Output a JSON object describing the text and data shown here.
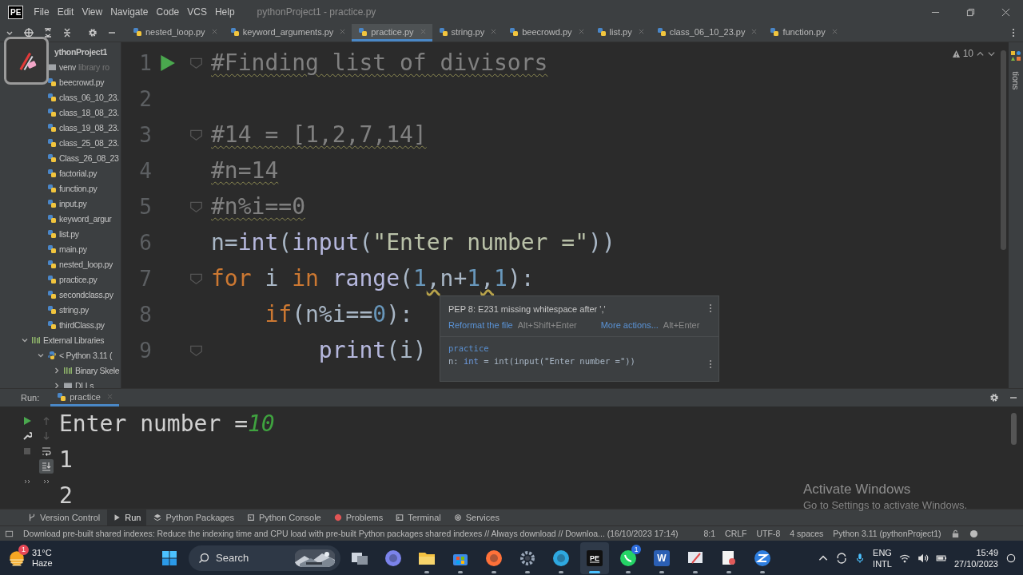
{
  "window": {
    "logo": "PE",
    "title": "pythonProject1 - practice.py"
  },
  "menu": [
    "File",
    "Edit",
    "View",
    "Navigate",
    "Code",
    "VCS",
    "Help"
  ],
  "tabs": [
    {
      "label": "nested_loop.py",
      "selected": false
    },
    {
      "label": "keyword_arguments.py",
      "selected": false
    },
    {
      "label": "practice.py",
      "selected": true
    },
    {
      "label": "string.py",
      "selected": false
    },
    {
      "label": "beecrowd.py",
      "selected": false
    },
    {
      "label": "list.py",
      "selected": false
    },
    {
      "label": "class_06_10_23.py",
      "selected": false
    },
    {
      "label": "function.py",
      "selected": false
    }
  ],
  "project_tree": [
    {
      "label": "ythonProject1",
      "kind": "root",
      "children": [
        {
          "label": "venv",
          "note": "library ro",
          "kind": "folder"
        },
        {
          "label": "beecrowd.py",
          "kind": "file"
        },
        {
          "label": "class_06_10_23.",
          "kind": "file"
        },
        {
          "label": "class_18_08_23.",
          "kind": "file"
        },
        {
          "label": "class_19_08_23.",
          "kind": "file"
        },
        {
          "label": "class_25_08_23.",
          "kind": "file"
        },
        {
          "label": "Class_26_08_23",
          "kind": "file"
        },
        {
          "label": "factorial.py",
          "kind": "file"
        },
        {
          "label": "function.py",
          "kind": "file"
        },
        {
          "label": "input.py",
          "kind": "file"
        },
        {
          "label": "keyword_argur",
          "kind": "file"
        },
        {
          "label": "list.py",
          "kind": "file"
        },
        {
          "label": "main.py",
          "kind": "file"
        },
        {
          "label": "nested_loop.py",
          "kind": "file"
        },
        {
          "label": "practice.py",
          "kind": "file"
        },
        {
          "label": "secondclass.py",
          "kind": "file"
        },
        {
          "label": "string.py",
          "kind": "file"
        },
        {
          "label": "thirdClass.py",
          "kind": "file"
        }
      ]
    },
    {
      "label": "External Libraries",
      "kind": "library",
      "expanded": true,
      "children": [
        {
          "label": "< Python 3.11 (",
          "kind": "python",
          "expanded": true,
          "children": [
            {
              "label": "Binary Skele",
              "kind": "library",
              "expanded": false
            },
            {
              "label": "DLLs",
              "kind": "folder",
              "expanded": false
            }
          ]
        }
      ]
    }
  ],
  "inspections": {
    "count": "10"
  },
  "editor_lines": [
    {
      "number": "1",
      "run": true,
      "fold": true,
      "tokens": [
        {
          "text": "#Finding list of divisors",
          "kind": "comment"
        }
      ]
    },
    {
      "number": "2",
      "run": false,
      "fold": false
    },
    {
      "number": "3",
      "run": false,
      "fold": true,
      "tokens": [
        {
          "text": "#14 = [1,2,7,14]",
          "kind": "comment"
        }
      ]
    },
    {
      "number": "4",
      "run": false,
      "fold": false,
      "tokens": [
        {
          "text": "#n=14",
          "kind": "comment"
        }
      ]
    },
    {
      "number": "5",
      "run": false,
      "fold": true,
      "tokens": [
        {
          "text": "#n%i==0",
          "kind": "comment"
        }
      ]
    },
    {
      "number": "6",
      "run": false,
      "fold": false,
      "tokens": [
        {
          "text": "n=",
          "kind": "plain"
        },
        {
          "text": "int",
          "kind": "builtin"
        },
        {
          "text": "(",
          "kind": "plain"
        },
        {
          "text": "input",
          "kind": "builtin"
        },
        {
          "text": "(",
          "kind": "plain"
        },
        {
          "text": "\"Enter number =\"",
          "kind": "string"
        },
        {
          "text": "))",
          "kind": "plain"
        }
      ]
    },
    {
      "number": "7",
      "run": false,
      "fold": true,
      "tokens": [
        {
          "text": "for",
          "kind": "keyword"
        },
        {
          "text": " i ",
          "kind": "plain"
        },
        {
          "text": "in",
          "kind": "keyword"
        },
        {
          "text": " range",
          "kind": "builtin"
        },
        {
          "text": "(",
          "kind": "plain"
        },
        {
          "text": "1",
          "kind": "number"
        },
        {
          "text": ",",
          "kind": "warn"
        },
        {
          "text": "n+",
          "kind": "plain"
        },
        {
          "text": "1",
          "kind": "number"
        },
        {
          "text": ",",
          "kind": "warn"
        },
        {
          "text": "1",
          "kind": "number"
        },
        {
          "text": "):",
          "kind": "plain"
        }
      ]
    },
    {
      "number": "8",
      "run": false,
      "fold": false,
      "tokens": [
        {
          "text": "    if",
          "kind": "keyword"
        },
        {
          "text": "(n%i==",
          "kind": "plain"
        },
        {
          "text": "0",
          "kind": "number"
        },
        {
          "text": "):",
          "kind": "plain"
        }
      ]
    },
    {
      "number": "9",
      "run": false,
      "fold": true,
      "tokens": [
        {
          "text": "        print",
          "kind": "builtin"
        },
        {
          "text": "(i)",
          "kind": "plain"
        }
      ]
    }
  ],
  "popup": {
    "title": "PEP 8: E231 missing whitespace after ','",
    "actions": [
      {
        "label": "Reformat the file",
        "shortcut": "Alt+Shift+Enter"
      },
      {
        "label": "More actions...",
        "shortcut": "Alt+Enter"
      }
    ],
    "source": "practice",
    "signature": [
      {
        "text": "n: ",
        "kind": "plain"
      },
      {
        "text": "int",
        "kind": "type"
      },
      {
        "text": " = int(input(\"Enter number =\"))",
        "kind": "plain"
      }
    ]
  },
  "run_panel": {
    "label": "Run:",
    "tabs": [
      {
        "label": "practice",
        "selected": true
      }
    ],
    "output": [
      {
        "segments": [
          {
            "text": "Enter number =",
            "kind": "out"
          },
          {
            "text": "10",
            "kind": "input"
          }
        ]
      },
      {
        "segments": [
          {
            "text": "1",
            "kind": "out"
          }
        ]
      },
      {
        "segments": [
          {
            "text": "2",
            "kind": "out"
          }
        ]
      }
    ]
  },
  "activation": {
    "title": "Activate Windows",
    "subtitle": "Go to Settings to activate Windows."
  },
  "tool_windows": [
    {
      "label": "Version Control",
      "selected": false
    },
    {
      "label": "Run",
      "selected": true
    },
    {
      "label": "Python Packages",
      "selected": false
    },
    {
      "label": "Python Console",
      "selected": false
    },
    {
      "label": "Problems",
      "selected": false
    },
    {
      "label": "Terminal",
      "selected": false
    },
    {
      "label": "Services",
      "selected": false
    }
  ],
  "status_bar": {
    "message": "Download pre-built shared indexes: Reduce the indexing time and CPU load with pre-built Python packages shared indexes // Always download // Downloa... (16/10/2023 17:14)",
    "items": [
      "8:1",
      "CRLF",
      "UTF-8",
      "4 spaces",
      "Python 3.11 (pythonProject1)"
    ]
  },
  "right_stripe": {
    "label": "tions"
  },
  "taskbar": {
    "weather": {
      "badge": "1",
      "temp": "31°C",
      "condition": "Haze"
    },
    "search": {
      "placeholder": "Search"
    },
    "apps": [
      {
        "running": false,
        "active": false
      },
      {
        "running": false,
        "active": false
      },
      {
        "running": true,
        "active": false
      },
      {
        "running": true,
        "active": false
      },
      {
        "running": true,
        "active": false
      },
      {
        "running": true,
        "active": false
      },
      {
        "running": true,
        "active": false
      },
      {
        "running": true,
        "active": true,
        "label": "PE"
      },
      {
        "running": true,
        "active": false,
        "badge": "1"
      },
      {
        "running": true,
        "active": false,
        "label": "W"
      },
      {
        "running": true,
        "active": false
      },
      {
        "running": true,
        "active": false
      },
      {
        "running": true,
        "active": false
      }
    ],
    "tray": {
      "language": "ENG",
      "layout": "INTL",
      "time": "15:49",
      "date": "27/10/2023"
    }
  }
}
